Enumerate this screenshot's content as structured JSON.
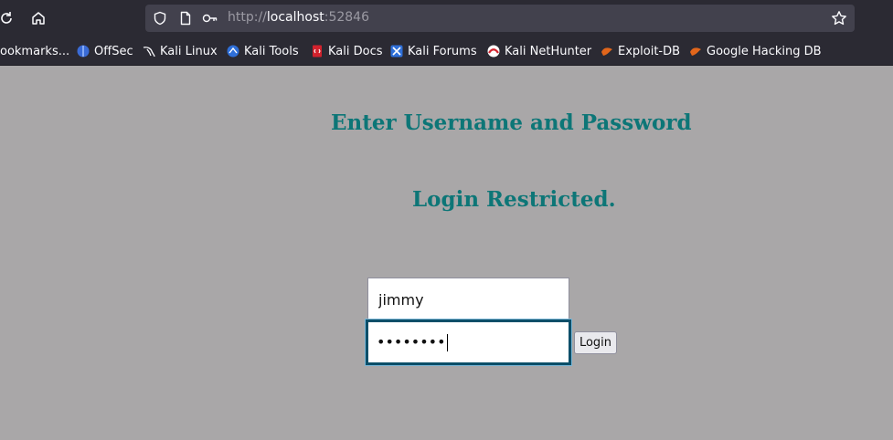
{
  "browser": {
    "url_scheme": "http://",
    "url_host": "localhost",
    "url_port": ":52846",
    "bookmarks": [
      {
        "label": "ookmarks...",
        "icon": "bookmarks-folder-icon"
      },
      {
        "label": "OffSec",
        "icon": "offsec-icon"
      },
      {
        "label": "Kali Linux",
        "icon": "kali-dragon-icon"
      },
      {
        "label": "Kali Tools",
        "icon": "kali-tools-icon"
      },
      {
        "label": "Kali Docs",
        "icon": "kali-docs-icon"
      },
      {
        "label": "Kali Forums",
        "icon": "kali-forums-icon"
      },
      {
        "label": "Kali NetHunter",
        "icon": "nethunter-icon"
      },
      {
        "label": "Exploit-DB",
        "icon": "exploit-db-icon"
      },
      {
        "label": "Google Hacking DB",
        "icon": "ghdb-icon"
      }
    ]
  },
  "page": {
    "heading1": "Enter Username and Password",
    "heading2": "Login Restricted.",
    "username_value": "jimmy",
    "password_mask": "••••••••",
    "login_label": "Login"
  },
  "colors": {
    "page_bg": "#a9a7a8",
    "heading": "#0d7677",
    "focus_border": "#0c4f69"
  }
}
